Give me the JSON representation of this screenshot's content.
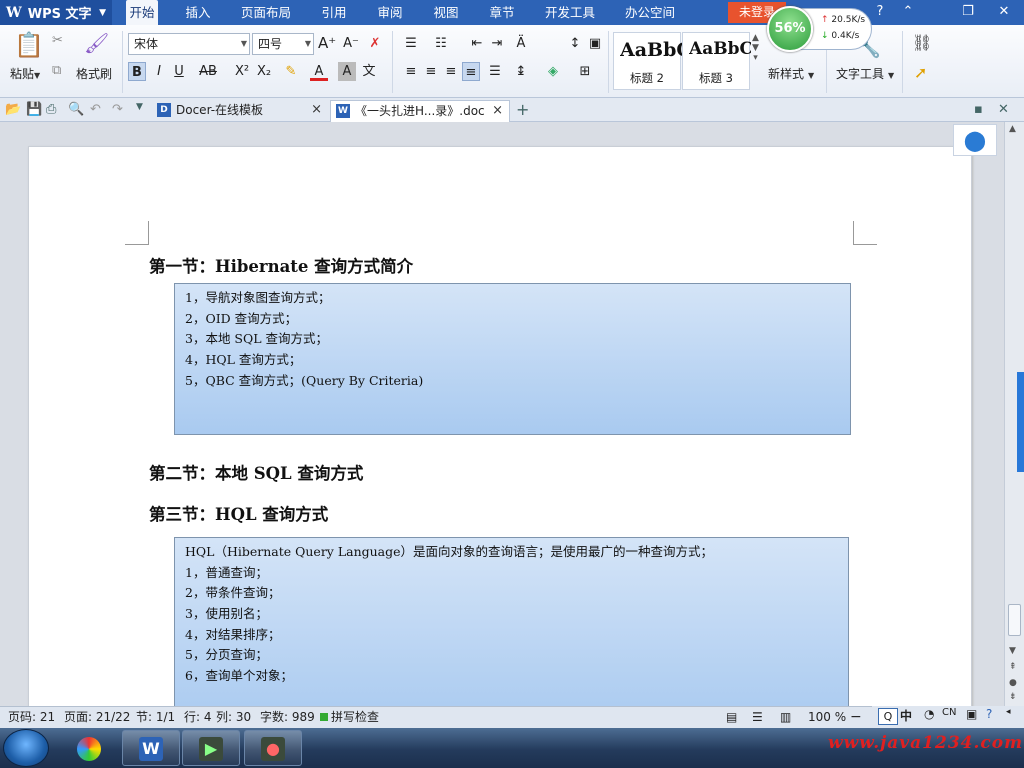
{
  "titlebar": {
    "app_name": "WPS 文字",
    "menu": [
      "开始",
      "插入",
      "页面布局",
      "引用",
      "审阅",
      "视图",
      "章节",
      "开发工具",
      "办公空间"
    ],
    "active_menu": "开始",
    "login_label": "未登录",
    "window_controls": [
      "?",
      "^",
      "restore",
      "close"
    ]
  },
  "net_widget": {
    "percent": "56%",
    "up": "20.5K/s",
    "down": "0.4K/s"
  },
  "ribbon": {
    "paste_label": "粘贴",
    "format_painter_label": "格式刷",
    "font_name": "宋体",
    "font_size": "四号",
    "styles": [
      {
        "preview": "AaBbC",
        "caption": "标题 2"
      },
      {
        "preview": "AaBbC",
        "caption": "标题 3"
      }
    ],
    "new_style_label": "新样式",
    "text_tools_label": "文字工具",
    "format_buttons": [
      "B",
      "I",
      "U",
      "AB",
      "X²",
      "X₂"
    ]
  },
  "tabs": [
    {
      "label": "Docer-在线模板",
      "icon": "D",
      "active": false
    },
    {
      "label": "《一头扎进H...录》.doc",
      "icon": "W",
      "active": true
    }
  ],
  "document": {
    "section1": {
      "heading": "第一节：Hibernate 查询方式简介",
      "lines": [
        "1，导航对象图查询方式；",
        "2，OID 查询方式；",
        "3，本地 SQL 查询方式；",
        "4，HQL 查询方式；",
        "5，QBC 查询方式；(Query By Criteria)"
      ]
    },
    "section2": {
      "heading": "第二节：本地 SQL 查询方式"
    },
    "section3": {
      "heading": "第三节：HQL 查询方式",
      "lines": [
        "HQL（Hibernate Query Language）是面向对象的查询语言；是使用最广的一种查询方式；",
        "1，普通查询；",
        "2，带条件查询；",
        "3，使用别名；",
        "4，对结果排序；",
        "5，分页查询；",
        "6，查询单个对象；"
      ]
    }
  },
  "statusbar": {
    "page_code": "页码: 21",
    "page": "页面: 21/22",
    "section": "节: 1/1",
    "row": "行: 4",
    "col": "列: 30",
    "word_count": "字数: 989",
    "spell_check": "拼写检查",
    "zoom": "100 %"
  },
  "ime": {
    "lang": "中",
    "cn": "CN"
  },
  "watermark": "www.java1234.com"
}
